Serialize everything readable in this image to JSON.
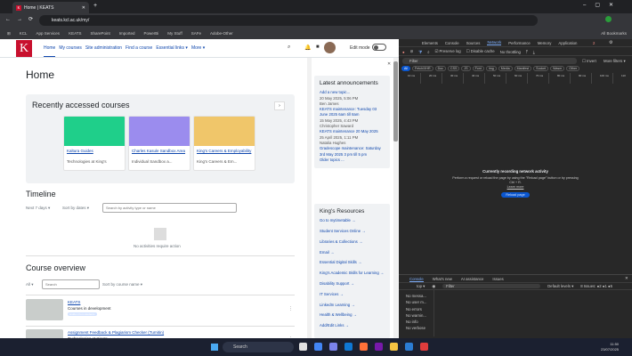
{
  "browser": {
    "tab_title": "Home | KEATS",
    "url": "keats.kcl.ac.uk/my/",
    "bookmarks": [
      "KCL",
      "App Services",
      "KEATS",
      "SharePoint",
      "Imported",
      "PowerBi",
      "My Stuff",
      "SAFe",
      "Adobe-Other"
    ],
    "all_bookmarks": "All Bookmarks"
  },
  "nav": {
    "logo": "K",
    "links": [
      "Home",
      "My courses",
      "Site administration",
      "Find a course",
      "Essential links ▾",
      "More ▾"
    ],
    "edit_mode": "Edit mode"
  },
  "main": {
    "title": "Home",
    "recent": {
      "title": "Recently accessed courses",
      "courses": [
        {
          "name": "Kaltura Guides",
          "category": "Technologies at King's",
          "color": "#1fcf8a"
        },
        {
          "name": "Charles Kasule Sandbox Area",
          "category": "Individual Sandbox a...",
          "color": "#9b8cee"
        },
        {
          "name": "King's Careers & Employability",
          "category": "King's Careers & Em...",
          "color": "#f0c66a"
        }
      ]
    },
    "timeline": {
      "title": "Timeline",
      "filter": "Next 7 days ▾",
      "sort": "Sort by dates ▾",
      "search_placeholder": "Search by activity type or name",
      "empty": "No activities require action"
    },
    "overview": {
      "title": "Course overview",
      "filter": "All ▾",
      "search_placeholder": "Search",
      "sort": "Sort by course name ▾",
      "courses": [
        {
          "name": "KEATS",
          "category": "Courses in development",
          "badge": "Hidden from students"
        },
        {
          "name": "Assignment Feedback & Plagiarism Checker (Turnitin)",
          "category": "Technologies at King's"
        }
      ]
    },
    "help": "?"
  },
  "drawer": {
    "announcements": {
      "title": "Latest announcements",
      "add": "Add a new topic...",
      "items": [
        {
          "date": "20 May 2025, 5:06 PM",
          "author": "Ben James",
          "title": "KEATS maintenance: Tuesday 03 June 2025 6am till 8am"
        },
        {
          "date": "15 May 2025, 4:43 PM",
          "author": "Christopher Saward",
          "title": "KEATS maintenance 20 May 2025"
        },
        {
          "date": "25 April 2025, 1:11 PM",
          "author": "Natalia Hughes",
          "title": "Gradescope maintenance: Saturday 3rd May 2025 3 pm till 5 pm"
        }
      ],
      "older": "Older topics ..."
    },
    "resources": {
      "title": "King's Resources",
      "links": [
        "Go to mytimetable →",
        "Student Services Online →",
        "Libraries & Collections →",
        "Email →",
        "Essential Digital Skills →",
        "King's Academic Skills for Learning →",
        "Disability Support →",
        "IT Services →",
        "LinkedIn Learning →",
        "Health & Wellbeing →",
        "Add/Edit Links →"
      ]
    }
  },
  "devtools": {
    "tabs": [
      "Elements",
      "Console",
      "Sources",
      "Network",
      "Performance",
      "Memory",
      "Application"
    ],
    "active_tab": "Network",
    "issues_badge": "2",
    "preserve_log": "Preserve log",
    "disable_cache": "Disable cache",
    "throttling": "No throttling",
    "filter_placeholder": "Filter",
    "invert": "Invert",
    "more_filters": "More filters ▾",
    "types": [
      "All",
      "Fetch/XHR",
      "Doc",
      "CSS",
      "JS",
      "Font",
      "Img",
      "Media",
      "Manifest",
      "Socket",
      "Wasm",
      "Other"
    ],
    "ticks": [
      "10 ms",
      "20 ms",
      "30 ms",
      "40 ms",
      "50 ms",
      "60 ms",
      "70 ms",
      "80 ms",
      "90 ms",
      "100 ms",
      "110"
    ],
    "empty_title": "Currently recording network activity",
    "empty_text": "Perform a request or reload the page by using the \"Reload page\" button or by pressing Ctrl + R.",
    "learn_more": "Learn more",
    "reload": "Reload page",
    "drawer_tabs": [
      "Console",
      "What's new",
      "AI assistance",
      "Issues"
    ],
    "context": "top ▾",
    "console_filter": "Filter",
    "levels": "Default levels ▾",
    "issues": "8 Issues: ●2 ●1 ●5",
    "sidebar": [
      "No messa...",
      "No user m...",
      "No errors",
      "No warnin...",
      "No info",
      "No verbose"
    ]
  },
  "taskbar": {
    "search": "Search",
    "time": "11:50",
    "date": "23/07/2025"
  }
}
